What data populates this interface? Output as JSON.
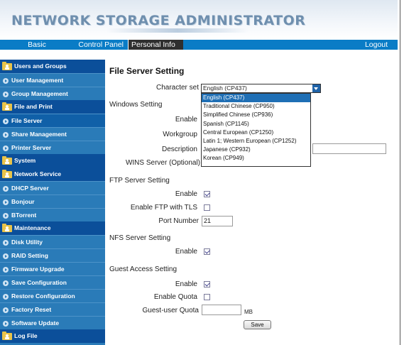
{
  "app": {
    "banner_title": "NETWORK STORAGE ADMINISTRATOR"
  },
  "top_nav": {
    "tabs": [
      {
        "label": "Basic"
      },
      {
        "label": "Control Panel"
      },
      {
        "label": "Personal Info"
      }
    ],
    "logout_label": "Logout"
  },
  "sidebar": {
    "users_and_groups": {
      "label": "Users and Groups",
      "items": [
        "User Management",
        "Group Management"
      ]
    },
    "file_and_print": {
      "label": "File and Print",
      "items": [
        "File Server",
        "Share Management",
        "Printer Server"
      ]
    },
    "system": {
      "label": "System"
    },
    "network_service": {
      "label": "Network Service",
      "items": [
        "DHCP Server",
        "Bonjour",
        "BTorrent"
      ]
    },
    "maintenance": {
      "label": "Maintenance",
      "items": [
        "Disk Utility",
        "RAID Setting",
        "Firmware Upgrade",
        "Save Configuration",
        "Restore Configuration",
        "Factory Reset",
        "Software Update"
      ]
    },
    "log_file": {
      "label": "Log File"
    },
    "active_item": "File Server"
  },
  "main": {
    "title": "File Server Setting",
    "character_set": {
      "label": "Character set",
      "selected": "English (CP437)",
      "options": [
        "English (CP437)",
        "Traditional Chinese (CP950)",
        "Simplified Chinese (CP936)",
        "Spanish (CP1145)",
        "Central European (CP1250)",
        "Latin 1; Western European (CP1252)",
        "Japanese (CP932)",
        "Korean (CP949)"
      ]
    },
    "windows_setting": {
      "heading": "Windows Setting",
      "enable_label": "Enable",
      "workgroup_label": "Workgroup",
      "description_label": "Description",
      "wins_label": "WINS Server (Optional)"
    },
    "ftp_setting": {
      "heading": "FTP Server Setting",
      "enable_label": "Enable",
      "enable_checked": true,
      "tls_label": "Enable FTP with TLS",
      "tls_checked": false,
      "port_label": "Port Number",
      "port_value": "21"
    },
    "nfs_setting": {
      "heading": "NFS Server Setting",
      "enable_label": "Enable",
      "enable_checked": true
    },
    "guest_setting": {
      "heading": "Guest Access Setting",
      "enable_label": "Enable",
      "enable_checked": true,
      "quota_label": "Enable Quota",
      "quota_checked": false,
      "user_quota_label": "Guest-user Quota",
      "user_quota_value": "",
      "unit": "MB"
    },
    "save_label": "Save"
  },
  "colors": {
    "nav_blue": "#0a7cc6",
    "sidebar_blue": "#2a7bb8",
    "sidebar_header": "#0b4f9a",
    "banner_text": "#6f8fae"
  }
}
